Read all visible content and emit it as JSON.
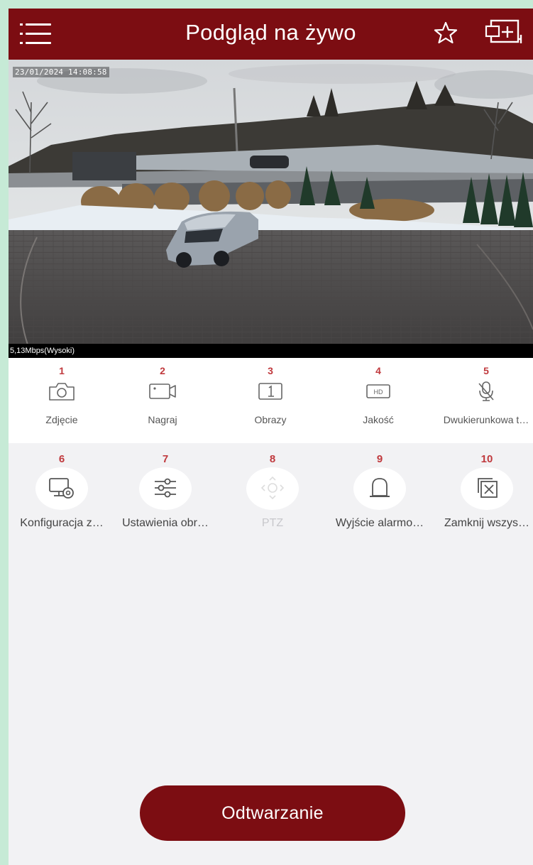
{
  "header": {
    "title": "Podgląd na żywo",
    "menu_icon": "hamburger-menu-icon",
    "favorite_icon": "star-outline-icon",
    "multiview_icon": "screen-add-icon",
    "background_color": "#7c0d12"
  },
  "video": {
    "timestamp": "23/01/2024 14:08:58",
    "bitrate": "5,13Mbps(Wysoki)"
  },
  "toolbar": {
    "items": [
      {
        "number": "1",
        "label": "Zdjęcie",
        "icon": "camera-icon"
      },
      {
        "number": "2",
        "label": "Nagraj",
        "icon": "video-record-icon"
      },
      {
        "number": "3",
        "label": "Obrazy",
        "icon": "single-view-icon"
      },
      {
        "number": "4",
        "label": "Jakość",
        "icon": "hd-icon"
      },
      {
        "number": "5",
        "label": "Dwukierunkowa t…",
        "icon": "microphone-off-icon"
      }
    ]
  },
  "more_tools": {
    "items": [
      {
        "number": "6",
        "label": "Konfiguracja z…",
        "icon": "monitor-settings-icon"
      },
      {
        "number": "7",
        "label": "Ustawienia obr…",
        "icon": "sliders-icon"
      },
      {
        "number": "8",
        "label": "PTZ",
        "icon": "ptz-directional-icon",
        "enabled": false
      },
      {
        "number": "9",
        "label": "Wyjście alarmo…",
        "icon": "alarm-light-icon"
      },
      {
        "number": "10",
        "label": "Zamknij wszys…",
        "icon": "close-all-windows-icon"
      }
    ]
  },
  "playback_button": {
    "label": "Odtwarzanie"
  },
  "colors": {
    "accent": "#7c0d12",
    "number_red": "#c0393d",
    "page_bg": "#f2f2f4"
  }
}
